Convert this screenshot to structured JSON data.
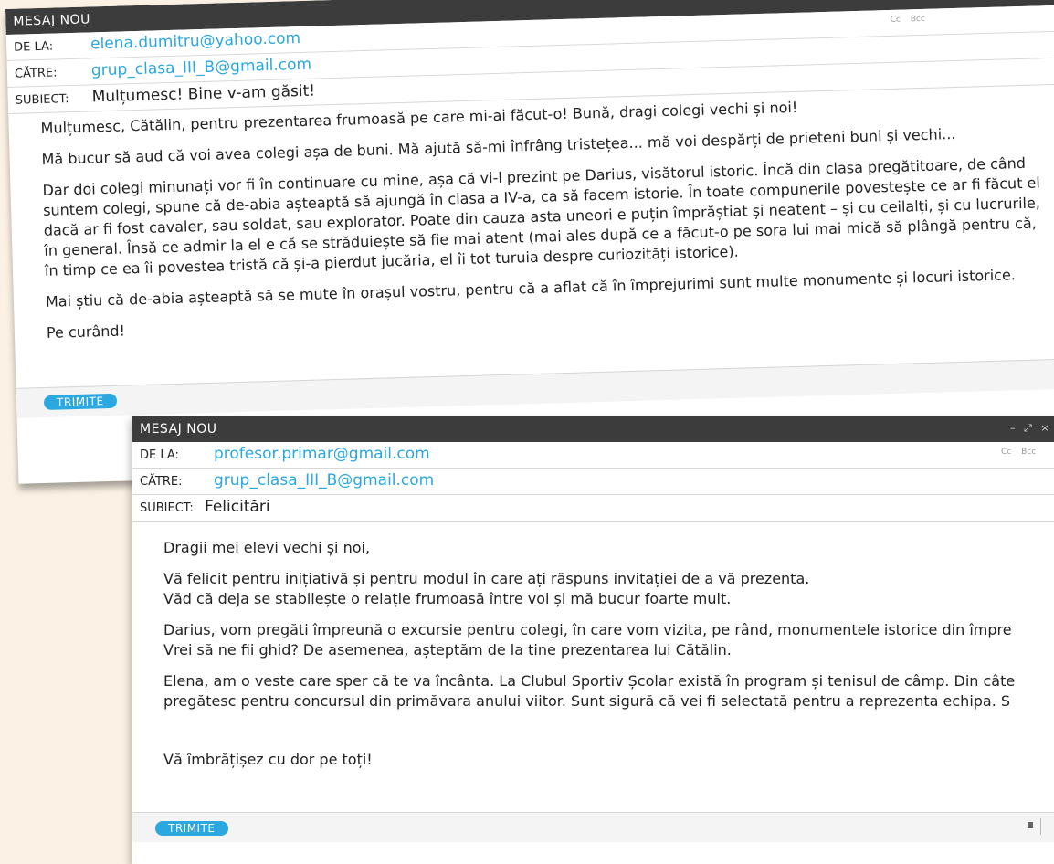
{
  "email1": {
    "title": "MESAJ NOU",
    "controls": [
      "–",
      "⤢",
      "×"
    ],
    "cc_label": "Cc",
    "bcc_label": "Bcc",
    "from_label": "DE LA:",
    "from_value": "elena.dumitru@yahoo.com",
    "to_label": "CĂTRE:",
    "to_value": "grup_clasa_III_B@gmail.com",
    "subject_label": "SUBIECT:",
    "subject_value": "Mulțumesc! Bine v-am găsit!",
    "paragraphs": [
      "Mulțumesc, Cătălin, pentru prezentarea frumoasă pe care mi-ai făcut-o! Bună, dragi colegi vechi și noi!",
      "Mă bucur să aud că voi avea colegi așa de buni. Mă ajută să-mi înfrâng tristețea... mă voi despărți de prieteni buni și vechi...",
      "Dar doi colegi minunați vor fi în continuare cu mine, așa că vi-l prezint pe Darius, visătorul istoric. Încă din clasa pregătitoare, de când suntem colegi, spune că de-abia așteaptă să ajungă în clasa a IV-a, ca să facem istorie. În toate compunerile povestește ce ar fi făcut el dacă ar fi fost cavaler, sau soldat, sau explorator. Poate din cauza asta uneori e puțin împrăștiat și neatent – și cu ceilalți, și cu lucrurile, în general. Însă ce admir la el e că se străduiește să fie mai atent (mai ales după ce a făcut-o pe sora lui mai mică să plângă pentru că, în timp ce ea îi povestea tristă că și-a pierdut jucăria, el îi tot turuia despre curiozități istorice).",
      "Mai știu că de-abia așteaptă să se mute în orașul vostru, pentru că a aflat că în împrejurimi sunt multe monumente și locuri istorice.",
      "Pe curând!"
    ],
    "send_label": "TRIMITE"
  },
  "email2": {
    "title": "MESAJ NOU",
    "controls": [
      "–",
      "⤢",
      "×"
    ],
    "cc_label": "Cc",
    "bcc_label": "Bcc",
    "from_label": "DE LA:",
    "from_value": "profesor.primar@gmail.com",
    "to_label": "CĂTRE:",
    "to_value": "grup_clasa_III_B@gmail.com",
    "subject_label": "SUBIECT:",
    "subject_value": "Felicitări",
    "greeting": "Dragii mei elevi vechi și noi,",
    "p1_line1": "Vă felicit pentru inițiativă și pentru modul în care ați răspuns invitației de a vă prezenta.",
    "p1_line2": "Văd că deja se stabilește o relație frumoasă între voi și mă bucur foarte mult.",
    "p2_line1": "Darius, vom pregăti împreună o excursie pentru colegi, în care vom vizita, pe rând, monumentele istorice din împre",
    "p2_line2": "Vrei să ne fii ghid? De asemenea, așteptăm de la tine prezentarea lui Cătălin.",
    "p3_line1": "Elena, am o veste care sper că te va încânta. La Clubul Sportiv Școlar există în program și tenisul de câmp. Din câte",
    "p3_line2": "pregătesc pentru concursul din primăvara anului viitor. Sunt sigură că vei fi selectată pentru a reprezenta echipa. S",
    "closing": "Vă îmbrățișez cu dor pe toți!",
    "send_label": "TRIMITE"
  }
}
